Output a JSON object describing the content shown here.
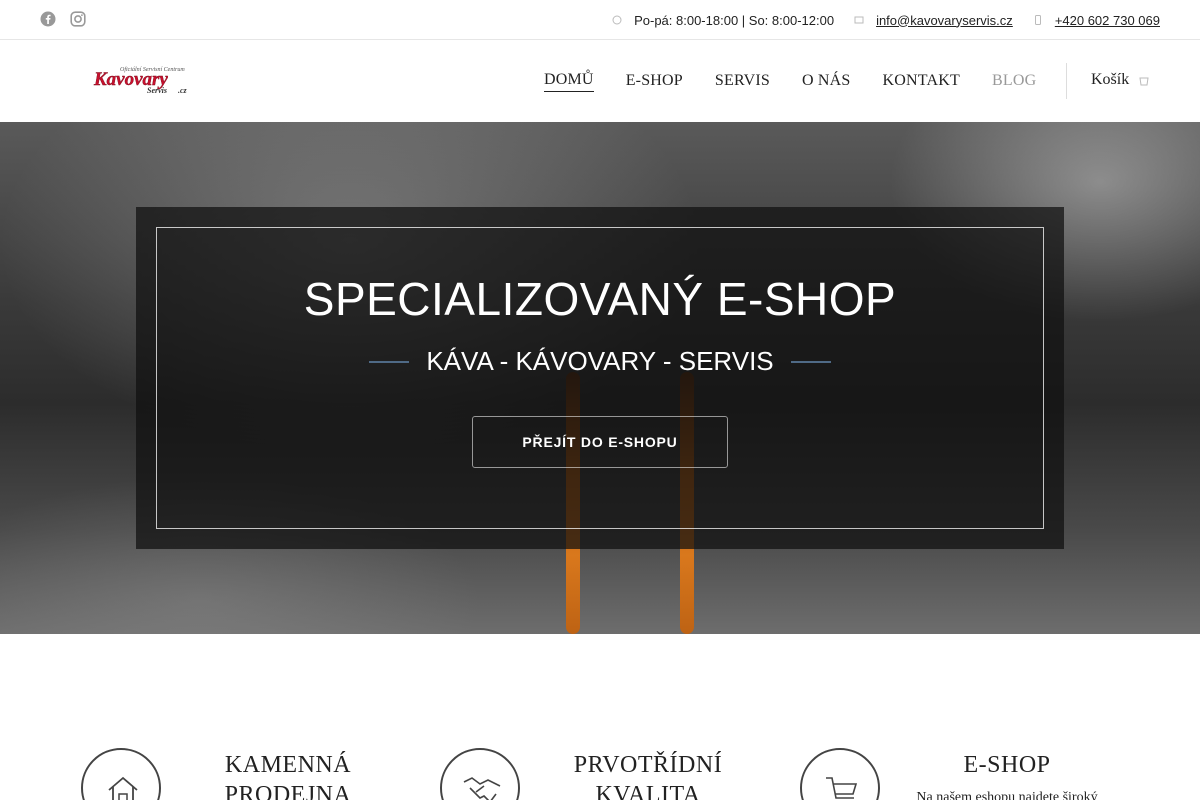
{
  "topbar": {
    "social": [
      {
        "icon": "facebook-icon"
      },
      {
        "icon": "instagram-icon"
      }
    ],
    "hours": "Po-pá: 8:00-18:00 | So: 8:00-12:00",
    "email": "info@kavovaryservis.cz",
    "phone": "+420 602 730 069"
  },
  "header": {
    "logo_text": "Kavovary",
    "logo_small": "Servis",
    "logo_domain": ".cz",
    "logo_tagline": "Oficiální Servisní Centrum",
    "nav": [
      "DOMŮ",
      "E-SHOP",
      "SERVIS",
      "O NÁS",
      "KONTAKT",
      "BLOG"
    ],
    "cart_label": "Košík"
  },
  "hero": {
    "title": "SPECIALIZOVANÝ E-SHOP",
    "subtitle": "KÁVA - KÁVOVARY - SERVIS",
    "button": "PŘEJÍT DO E-SHOPU"
  },
  "features": [
    {
      "icon": "store-icon",
      "title_line1": "KAMENNÁ",
      "title_line2": "PRODEJNA"
    },
    {
      "icon": "handshake-icon",
      "title_line1": "PRVOTŘÍDNÍ",
      "title_line2": "KVALITA"
    },
    {
      "icon": "cart-icon",
      "title_line1": "E-SHOP",
      "text": "Na našem eshopu najdete široký"
    }
  ],
  "colors": {
    "accent_line": "#4f6a86",
    "logo_red": "#c8102e"
  }
}
